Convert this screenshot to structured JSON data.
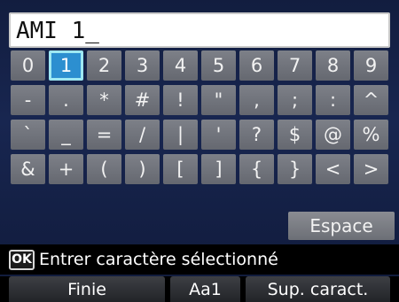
{
  "entry": {
    "value": "AMI 1_"
  },
  "keypad": {
    "selected_key": "1",
    "rows": [
      [
        "0",
        "1",
        "2",
        "3",
        "4",
        "5",
        "6",
        "7",
        "8",
        "9"
      ],
      [
        "-",
        ".",
        "*",
        "#",
        "!",
        "\"",
        ",",
        ";",
        ":",
        "^"
      ],
      [
        "`",
        "_",
        "=",
        "/",
        "|",
        "'",
        "?",
        "$",
        "@",
        "%"
      ],
      [
        "&",
        "+",
        "(",
        ")",
        "[",
        "]",
        "{",
        "}",
        "<",
        ">"
      ]
    ]
  },
  "space_key": {
    "label": "Espace"
  },
  "hint": {
    "ok_label": "OK",
    "text": "Entrer caractère sélectionné"
  },
  "function_buttons": {
    "left": "Finie",
    "middle": "Aa1",
    "right": "Sup. caract."
  },
  "colors": {
    "background": "#182650",
    "key": "#6f727a",
    "selected_key": "#2c8fd0",
    "selected_border": "#9ee8f2"
  }
}
